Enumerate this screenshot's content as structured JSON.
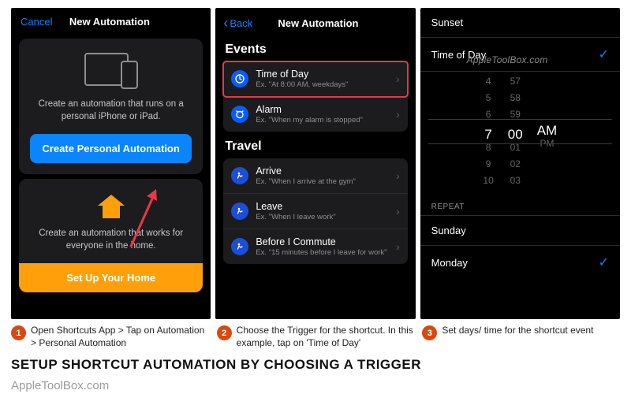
{
  "screen1": {
    "cancel": "Cancel",
    "title": "New Automation",
    "card1_desc": "Create an automation that runs on a personal iPhone or iPad.",
    "card1_button": "Create Personal Automation",
    "card2_desc": "Create an automation that works for everyone in the home.",
    "card2_button": "Set Up Your Home"
  },
  "screen2": {
    "back": "Back",
    "title": "New Automation",
    "section_events": "Events",
    "row_time_label": "Time of Day",
    "row_time_sub": "Ex. \"At 8:00 AM, weekdays\"",
    "row_alarm_label": "Alarm",
    "row_alarm_sub": "Ex. \"When my alarm is stopped\"",
    "section_travel": "Travel",
    "row_arrive_label": "Arrive",
    "row_arrive_sub": "Ex. \"When I arrive at the gym\"",
    "row_leave_label": "Leave",
    "row_leave_sub": "Ex. \"When I leave work\"",
    "row_commute_label": "Before I Commute",
    "row_commute_sub": "Ex. \"15 minutes before I leave for work\""
  },
  "screen3": {
    "sunset": "Sunset",
    "timeofday": "Time of Day",
    "watermark": "AppleToolBox.com",
    "picker_hours": [
      "4",
      "5",
      "6",
      "7",
      "8",
      "9",
      "10"
    ],
    "picker_mins": [
      "57",
      "58",
      "59",
      "00",
      "01",
      "02",
      "03"
    ],
    "picker_ampm_am": "AM",
    "picker_ampm_pm": "PM",
    "repeat": "Repeat",
    "sunday": "Sunday",
    "monday": "Monday"
  },
  "captions": {
    "c1": "Open Shortcuts App > Tap on Automation > Personal Automation",
    "c2": "Choose the Trigger for the shortcut. In this example, tap on 'Time of Day'",
    "c3": "Set days/ time for the shortcut event"
  },
  "headline": "SETUP SHORTCUT AUTOMATION BY CHOOSING A TRIGGER",
  "footer": "AppleToolBox.com"
}
